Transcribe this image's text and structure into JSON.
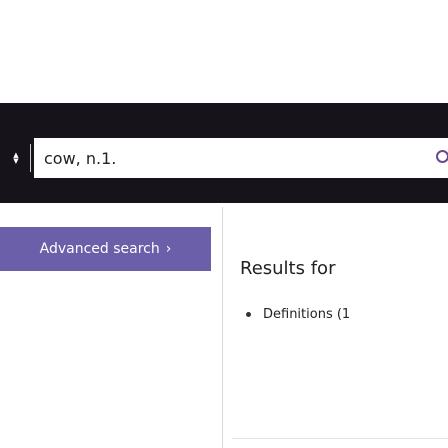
{
  "search": {
    "query": "cow, n.1."
  },
  "sidebar": {
    "advanced_search_label": "Advanced search",
    "advanced_search_chevron": "›"
  },
  "results": {
    "heading": "Results for",
    "items": [
      {
        "label": "Definitions (1"
      }
    ]
  },
  "icons": {
    "select_arrows": "updown-arrows-icon",
    "search": "magnifier-icon",
    "advanced_chevron": "chevron-right-icon"
  },
  "colors": {
    "search_band": "#16141a",
    "advanced_button": "#6a5fa8",
    "search_icon": "#6b4a8a"
  }
}
